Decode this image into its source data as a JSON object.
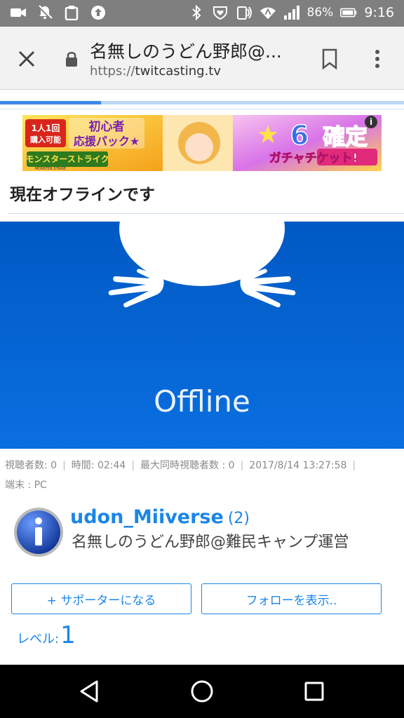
{
  "status_bar": {
    "battery_percent": "86%",
    "time": "9:16"
  },
  "browser": {
    "page_title": "名無しのうどん野郎@...",
    "url_scheme": "https://",
    "url_host": "twitcasting.tv",
    "loading_progress": 0.25
  },
  "ad": {
    "badge_line1": "1人1回",
    "badge_line2": "購入可能",
    "headline_line1": "初心者",
    "headline_line2": "応援パック★",
    "game_logo": "モンスターストライク",
    "game_logo_en": "MONSTER STRIKE",
    "promo_number": "6",
    "promo_word": "確定",
    "promo_sub": "ガチャチケット!",
    "info_icon": "i"
  },
  "stream": {
    "status_heading": "現在オフラインです",
    "video_overlay_text": "Offline"
  },
  "meta": {
    "viewers": "視聴者数: 0",
    "time": "時間: 02:44",
    "max_viewers": "最大同時視聴者数 : 0",
    "date": "2017/8/14 13:27:58",
    "device": "端末 : PC"
  },
  "user": {
    "username": "udon_Miiverse",
    "count": "(2)",
    "display_name": "名無しのうどん野郎@難民キャンプ運営"
  },
  "buttons": {
    "supporter": "+ サポーターになる",
    "follow": "フォローを表示.."
  },
  "level": {
    "label": "レベル:",
    "value": "1"
  },
  "colors": {
    "accent": "#1a86e8",
    "video_bg": "#0062d0",
    "status_bar": "#7f7f7f"
  },
  "icons": [
    "camera-icon",
    "notification-off-icon",
    "clipboard-icon",
    "upload-icon",
    "bluetooth-icon",
    "heart-shield-icon",
    "nfc-icon",
    "wifi-icon",
    "signal-icon",
    "battery-icon",
    "close-icon",
    "lock-icon",
    "bookmark-icon",
    "more-vert-icon",
    "back-icon",
    "home-icon",
    "recents-icon"
  ]
}
